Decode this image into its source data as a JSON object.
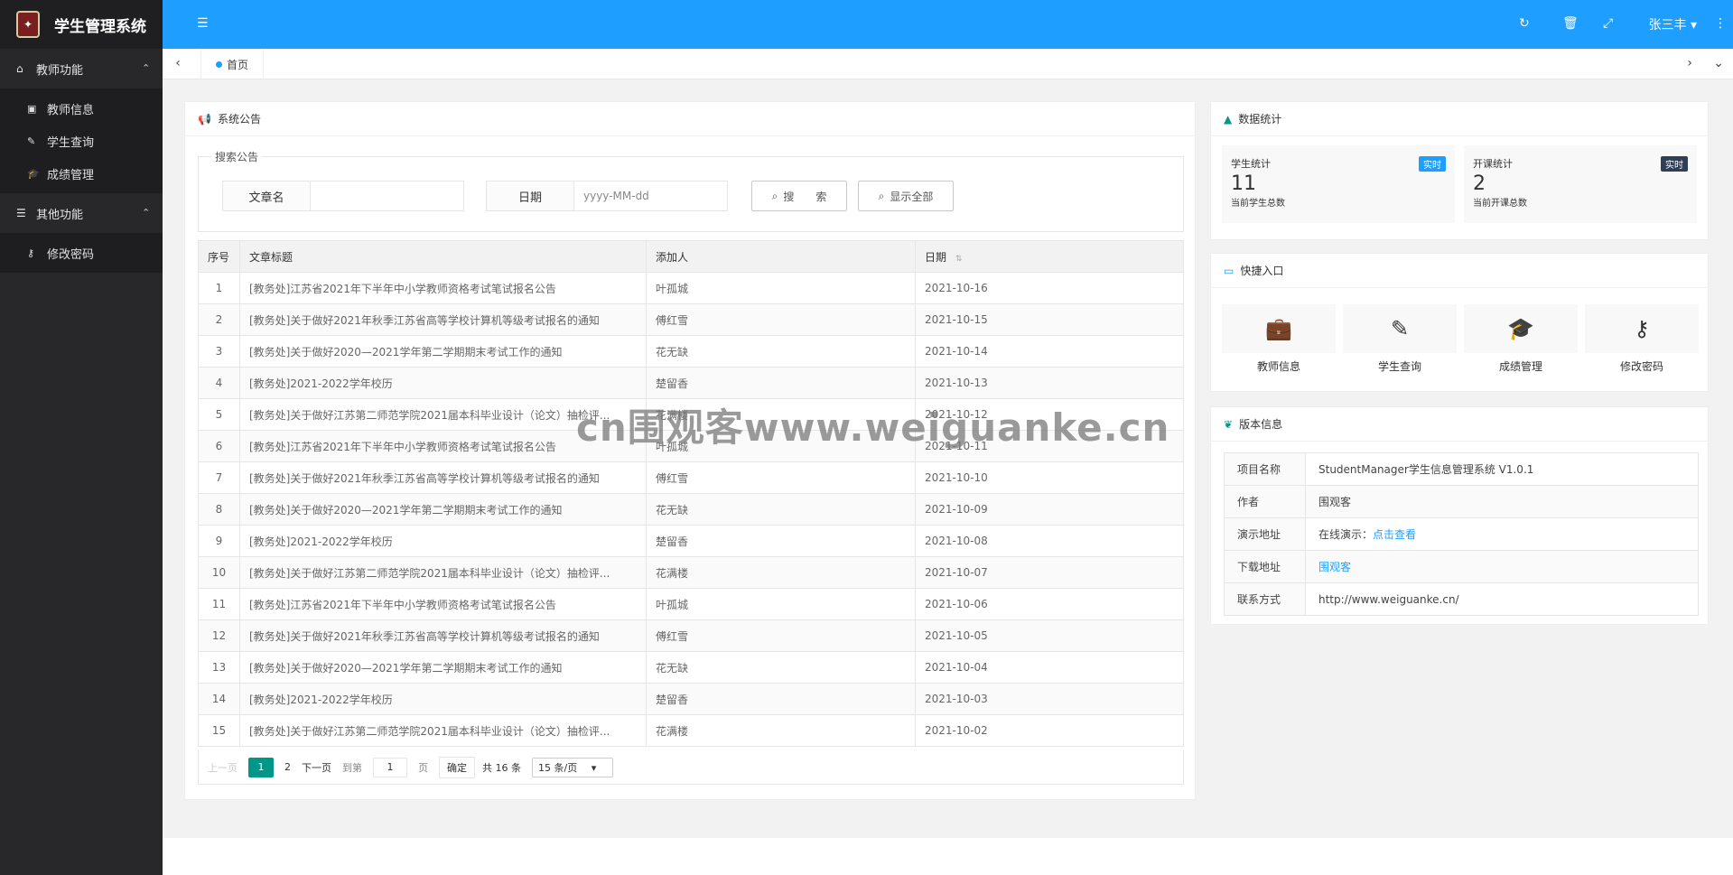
{
  "app": {
    "title": "学生管理系统",
    "logo_icon": "university-seal-icon"
  },
  "sidebar": {
    "groups": [
      {
        "label": "教师功能",
        "icon": "home-icon",
        "items": [
          {
            "label": "教师信息"
          },
          {
            "label": "学生查询"
          },
          {
            "label": "成绩管理"
          }
        ]
      },
      {
        "label": "其他功能",
        "icon": "menu-list-icon",
        "items": [
          {
            "label": "修改密码"
          }
        ]
      }
    ]
  },
  "header": {
    "user_name": "张三丰",
    "accent": "#1e9fff"
  },
  "tabs": [
    {
      "label": "首页"
    }
  ],
  "notice": {
    "title": "系统公告",
    "search_legend": "搜索公告",
    "name_label": "文章名",
    "name_value": "",
    "date_label": "日期",
    "date_placeholder": "yyyy-MM-dd",
    "search_btn": "搜　　索",
    "show_all_btn": "显示全部",
    "columns": [
      "序号",
      "文章标题",
      "添加人",
      "日期"
    ],
    "rows": [
      [
        "1",
        "[教务处]江苏省2021年下半年中小学教师资格考试笔试报名公告",
        "叶孤城",
        "2021-10-16"
      ],
      [
        "2",
        "[教务处]关于做好2021年秋季江苏省高等学校计算机等级考试报名的通知",
        "傅红雪",
        "2021-10-15"
      ],
      [
        "3",
        "[教务处]关于做好2020—2021学年第二学期期末考试工作的通知",
        "花无缺",
        "2021-10-14"
      ],
      [
        "4",
        "[教务处]2021-2022学年校历",
        "楚留香",
        "2021-10-13"
      ],
      [
        "5",
        "[教务处]关于做好江苏第二师范学院2021届本科毕业设计（论文）抽检评...",
        "花满楼",
        "2021-10-12"
      ],
      [
        "6",
        "[教务处]江苏省2021年下半年中小学教师资格考试笔试报名公告",
        "叶孤城",
        "2021-10-11"
      ],
      [
        "7",
        "[教务处]关于做好2021年秋季江苏省高等学校计算机等级考试报名的通知",
        "傅红雪",
        "2021-10-10"
      ],
      [
        "8",
        "[教务处]关于做好2020—2021学年第二学期期末考试工作的通知",
        "花无缺",
        "2021-10-09"
      ],
      [
        "9",
        "[教务处]2021-2022学年校历",
        "楚留香",
        "2021-10-08"
      ],
      [
        "10",
        "[教务处]关于做好江苏第二师范学院2021届本科毕业设计（论文）抽检评...",
        "花满楼",
        "2021-10-07"
      ],
      [
        "11",
        "[教务处]江苏省2021年下半年中小学教师资格考试笔试报名公告",
        "叶孤城",
        "2021-10-06"
      ],
      [
        "12",
        "[教务处]关于做好2021年秋季江苏省高等学校计算机等级考试报名的通知",
        "傅红雪",
        "2021-10-05"
      ],
      [
        "13",
        "[教务处]关于做好2020—2021学年第二学期期末考试工作的通知",
        "花无缺",
        "2021-10-04"
      ],
      [
        "14",
        "[教务处]2021-2022学年校历",
        "楚留香",
        "2021-10-03"
      ],
      [
        "15",
        "[教务处]关于做好江苏第二师范学院2021届本科毕业设计（论文）抽检评...",
        "花满楼",
        "2021-10-02"
      ]
    ],
    "pager": {
      "prev": "上一页",
      "page1": "1",
      "page2": "2",
      "next": "下一页",
      "goto": "到第",
      "goto_value": "1",
      "page_unit": "页",
      "confirm": "确定",
      "total": "共 16 条",
      "per_page": "15 条/页"
    }
  },
  "stats": {
    "title": "数据统计",
    "student": {
      "label": "学生统计",
      "badge": "实时",
      "value": "11",
      "desc": "当前学生总数"
    },
    "course": {
      "label": "开课统计",
      "badge": "实时",
      "value": "2",
      "desc": "当前开课总数"
    }
  },
  "quick": {
    "title": "快捷入口",
    "items": [
      {
        "label": "教师信息",
        "icon": "briefcase-icon"
      },
      {
        "label": "学生查询",
        "icon": "pencil-icon"
      },
      {
        "label": "成绩管理",
        "icon": "graduation-cap-icon"
      },
      {
        "label": "修改密码",
        "icon": "key-icon"
      }
    ]
  },
  "version": {
    "title": "版本信息",
    "rows": [
      {
        "key": "项目名称",
        "value": "StudentManager学生信息管理系统 V1.0.1"
      },
      {
        "key": "作者",
        "value": "围观客"
      },
      {
        "key": "演示地址",
        "value": "在线演示：",
        "link": "点击查看"
      },
      {
        "key": "下载地址",
        "value": "",
        "link": "围观客"
      },
      {
        "key": "联系方式",
        "value": "http://www.weiguanke.cn/"
      }
    ]
  },
  "watermark": "cn围观客www.weiguanke.cn"
}
